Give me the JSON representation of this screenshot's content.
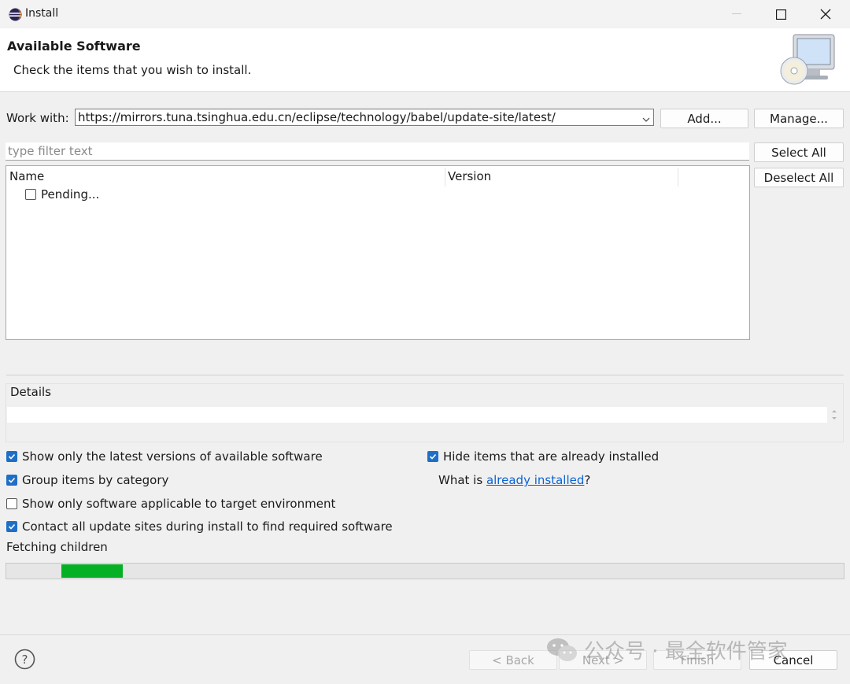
{
  "window": {
    "title": "Install"
  },
  "header": {
    "title": "Available Software",
    "description": "Check the items that you wish to install."
  },
  "work_with": {
    "label": "Work with:",
    "value": "https://mirrors.tuna.tsinghua.edu.cn/eclipse/technology/babel/update-site/latest/",
    "add_label": "Add...",
    "manage_label": "Manage..."
  },
  "filter": {
    "placeholder": "type filter text"
  },
  "buttons": {
    "select_all": "Select All",
    "deselect_all": "Deselect All"
  },
  "tree": {
    "columns": [
      "Name",
      "Version"
    ],
    "items": [
      {
        "label": "Pending...",
        "checked": false
      }
    ]
  },
  "details": {
    "label": "Details"
  },
  "options": {
    "latest_versions": {
      "label": "Show only the latest versions of available software",
      "checked": true
    },
    "group_by_category": {
      "label": "Group items by category",
      "checked": true
    },
    "target_env": {
      "label": "Show only software applicable to target environment",
      "checked": false
    },
    "contact_sites": {
      "label": "Contact all update sites during install to find required software",
      "checked": true
    },
    "hide_installed": {
      "label": "Hide items that are already installed",
      "checked": true
    },
    "what_is_prefix": "What is ",
    "what_is_link": "already installed",
    "what_is_suffix": "?"
  },
  "status": {
    "text": "Fetching children",
    "progress_segment": [
      0.066,
      0.139
    ]
  },
  "footer": {
    "back": "< Back",
    "next": "Next >",
    "finish": "Finish",
    "cancel": "Cancel",
    "watermark": "公众号 · 最全软件管家"
  },
  "colors": {
    "accent": "#1f6fc6",
    "progress": "#06b025",
    "link": "#0b63d1"
  },
  "icons": [
    "eclipse-icon",
    "minimize-icon",
    "maximize-icon",
    "close-icon",
    "install-cd-icon",
    "dropdown-arrow-icon",
    "help-icon",
    "checkmark-icon",
    "wechat-icon"
  ]
}
